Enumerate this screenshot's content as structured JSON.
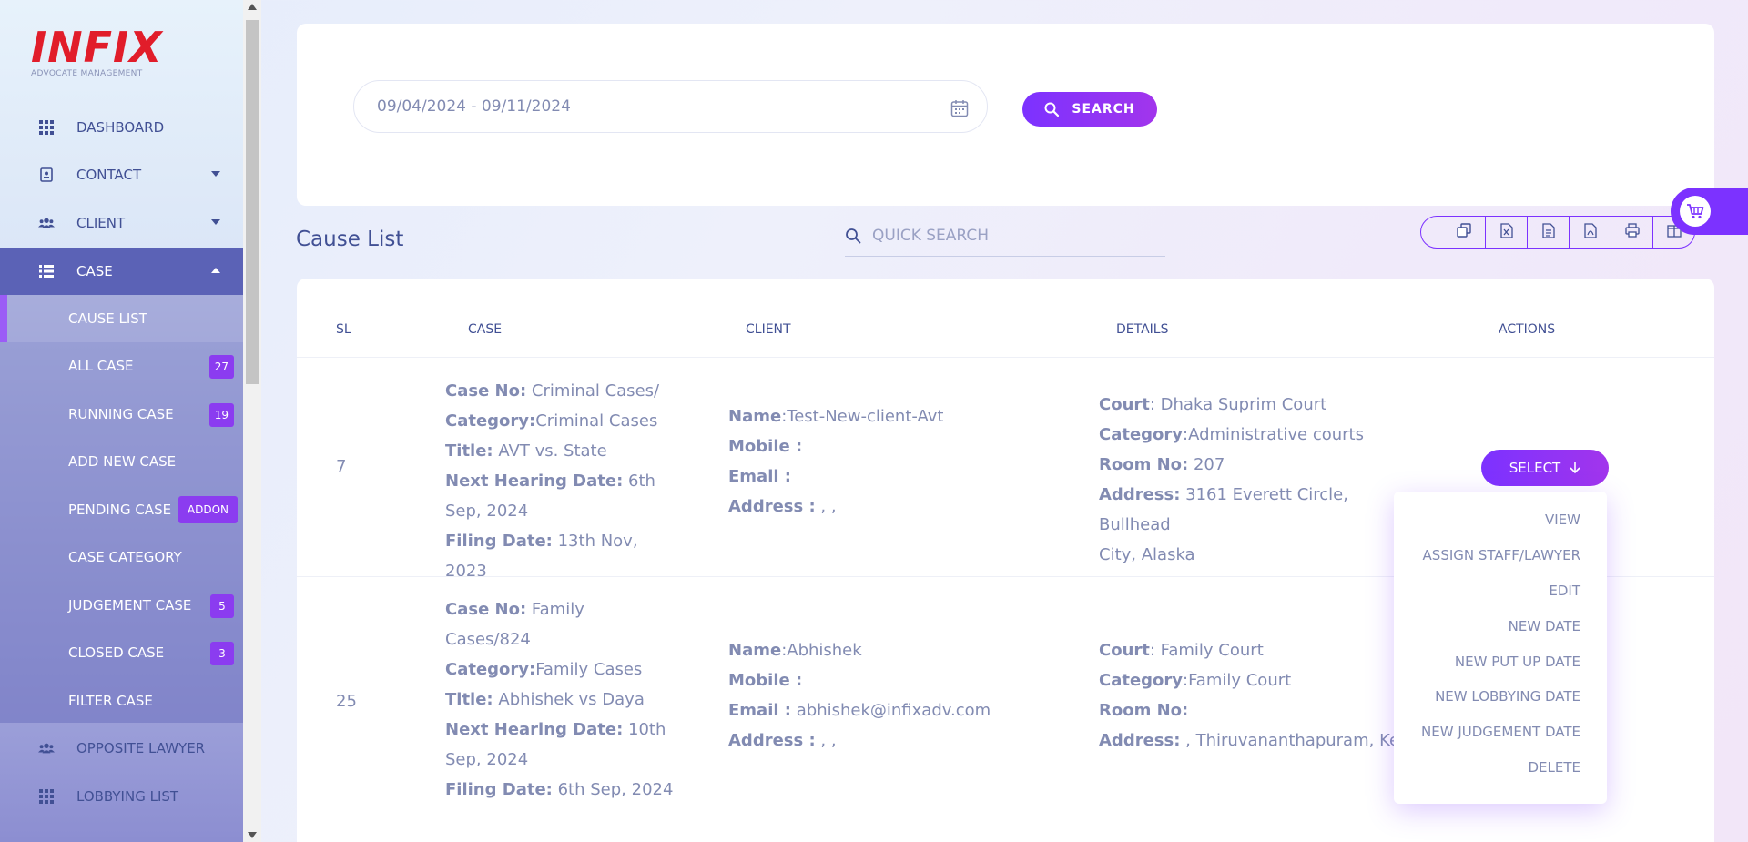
{
  "app": {
    "brand": "INFIX",
    "brand_sub": "ADVOCATE MANAGEMENT"
  },
  "sidebar": {
    "items": [
      {
        "label": "DASHBOARD",
        "icon": "grid-icon"
      },
      {
        "label": "CONTACT",
        "icon": "contact-card-icon"
      },
      {
        "label": "CLIENT",
        "icon": "users-icon"
      },
      {
        "label": "CASE",
        "icon": "list-icon"
      },
      {
        "label": "OPPOSITE LAWYER",
        "icon": "users-icon"
      },
      {
        "label": "LOBBYING LIST",
        "icon": "grid-icon"
      }
    ],
    "case_submenu": [
      {
        "label": "CAUSE LIST",
        "badge": ""
      },
      {
        "label": "ALL CASE",
        "badge": "27"
      },
      {
        "label": "RUNNING CASE",
        "badge": "19"
      },
      {
        "label": "ADD NEW CASE",
        "badge": ""
      },
      {
        "label": "PENDING CASE",
        "badge": "ADDON"
      },
      {
        "label": "CASE CATEGORY",
        "badge": ""
      },
      {
        "label": "JUDGEMENT CASE",
        "badge": "5"
      },
      {
        "label": "CLOSED CASE",
        "badge": "3"
      },
      {
        "label": "FILTER CASE",
        "badge": ""
      }
    ]
  },
  "filter": {
    "date_range": "09/04/2024 - 09/11/2024",
    "search_label": "SEARCH"
  },
  "main": {
    "title": "Cause List",
    "quick_search_placeholder": "QUICK SEARCH"
  },
  "table": {
    "headers": {
      "sl": "SL",
      "case": "CASE",
      "client": "CLIENT",
      "details": "DETAILS",
      "actions": "ACTIONS"
    },
    "rows": [
      {
        "sl": "7",
        "case_no_label": "Case No:",
        "case_no_1": "Criminal Cases/",
        "case_no_2": "",
        "category_label": "Category:",
        "category": "Criminal Cases",
        "title_label": "Title:",
        "title": "AVT vs. State",
        "next_label": "Next Hearing Date:",
        "next_1": "6th",
        "next_2": "Sep, 2024",
        "filing_label": "Filing Date:",
        "filing": "13th Nov, 2023",
        "name_label": "Name",
        "name": ":Test-New-client-Avt",
        "mobile_label": "Mobile :",
        "mobile": "",
        "email_label": "Email :",
        "email": "",
        "address_label": "Address :",
        "address": " , ,",
        "court_label": "Court",
        "court": ": Dhaka Suprim Court",
        "dcategory_label": "Category",
        "dcategory": ":Administrative courts",
        "room_label": "Room No:",
        "room": " 207",
        "daddress_label": "Address:",
        "daddress_1": " 3161 Everett Circle, Bullhead",
        "daddress_2": "City, Alaska"
      },
      {
        "sl": "25",
        "case_no_label": "Case No:",
        "case_no_1": "Family",
        "case_no_2": "Cases/824",
        "category_label": "Category:",
        "category": "Family Cases",
        "title_label": "Title:",
        "title": "Abhishek vs Daya",
        "next_label": "Next Hearing Date:",
        "next_1": "10th",
        "next_2": "Sep, 2024",
        "filing_label": "Filing Date:",
        "filing": "6th Sep, 2024",
        "name_label": "Name",
        "name": ":Abhishek",
        "mobile_label": "Mobile :",
        "mobile": "",
        "email_label": "Email :",
        "email": " abhishek@infixadv.com",
        "address_label": "Address :",
        "address": " , ,",
        "court_label": "Court",
        "court": ": Family Court",
        "dcategory_label": "Category",
        "dcategory": ":Family Court",
        "room_label": "Room No:",
        "room": "",
        "daddress_label": "Address:",
        "daddress_1": " , Thiruvananthapuram, Kera",
        "daddress_2": ""
      }
    ],
    "select_label": "SELECT"
  },
  "dropdown": {
    "items": [
      "VIEW",
      "ASSIGN STAFF/LAWYER",
      "EDIT",
      "NEW DATE",
      "NEW PUT UP DATE",
      "NEW LOBBYING DATE",
      "NEW JUDGEMENT DATE",
      "DELETE"
    ]
  },
  "colors": {
    "accent": "#7c32ff",
    "brand_red": "#e11d2a",
    "text": "#415094",
    "muted": "#828bb2"
  }
}
